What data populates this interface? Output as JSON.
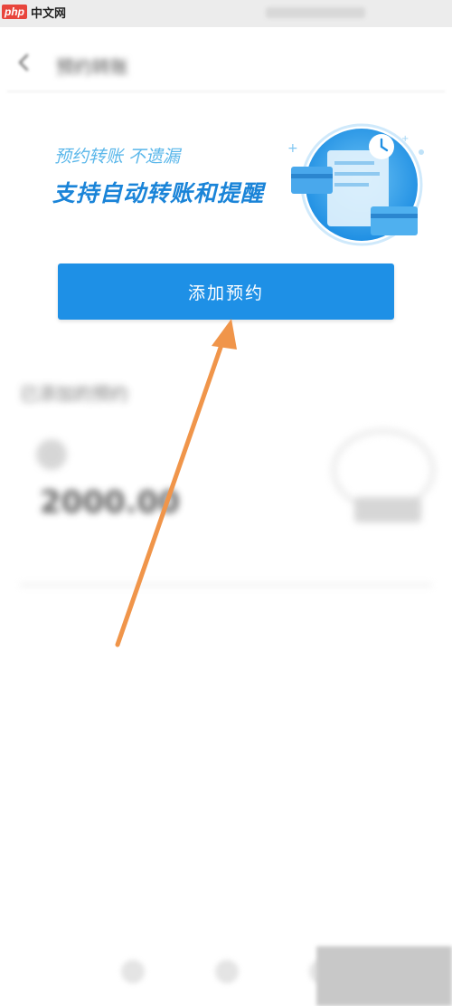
{
  "status_bar": {
    "logo_badge": "php",
    "logo_text": "中文网"
  },
  "header": {
    "back_icon": "chevron-left-icon",
    "title": "预约转账"
  },
  "banner": {
    "subtitle": "预约转账 不遗漏",
    "headline": "支持自动转账和提醒",
    "illustration_icon": "calendar-card-icon",
    "accent": "#1a84d8"
  },
  "actions": {
    "add_label": "添加预约",
    "button_color": "#1e90e6"
  },
  "list": {
    "title": "已添加的预约",
    "record": {
      "name": "",
      "amount": "2000.00",
      "date": "",
      "note": ""
    }
  },
  "annotation": {
    "arrow_color": "#f0954a"
  },
  "bottom_nav": {
    "icons": [
      "home-icon",
      "discover-icon",
      "profile-icon"
    ]
  }
}
